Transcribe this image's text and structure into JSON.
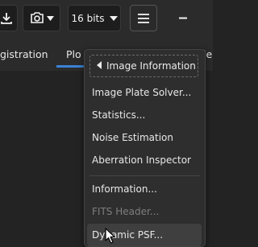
{
  "toolbar": {
    "save_icon": "download-icon",
    "camera_icon": "camera-icon",
    "bits_label": "16 bits",
    "menu_icon": "hamburger-icon",
    "minimize_icon": "minimize-icon"
  },
  "tabs": [
    {
      "label": "gistration"
    },
    {
      "label": "Plo"
    },
    {
      "label": "le"
    }
  ],
  "menu": {
    "header": "Image Information",
    "items": [
      {
        "label": "Image Plate Solver..."
      },
      {
        "label": "Statistics..."
      },
      {
        "label": "Noise Estimation"
      },
      {
        "label": "Aberration Inspector"
      },
      {
        "label": "Information..."
      },
      {
        "label": "FITS Header..."
      },
      {
        "label": "Dynamic PSF..."
      }
    ]
  },
  "colors": {
    "accent": "#3b82d6",
    "background": "#232323",
    "menu_background": "#2e2e2e",
    "disabled_text": "#7e7e7e"
  }
}
